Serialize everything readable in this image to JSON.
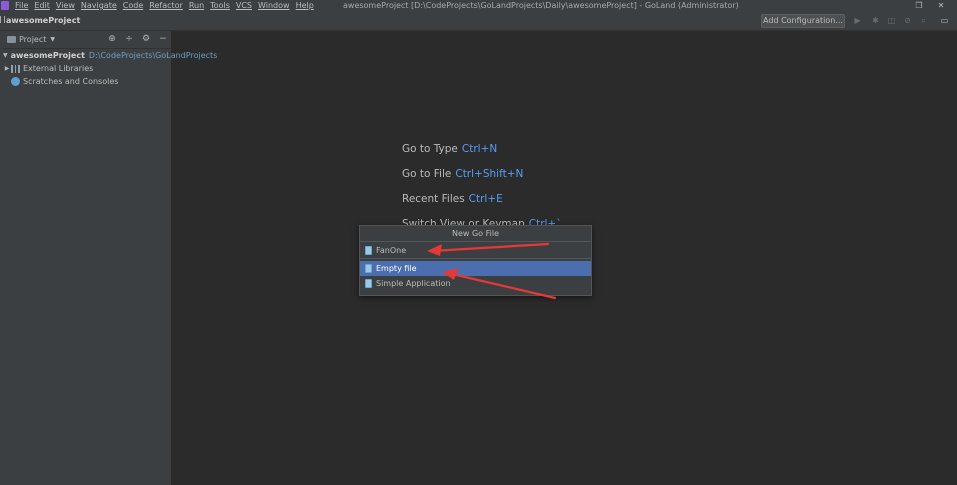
{
  "menubar": {
    "items": [
      "File",
      "Edit",
      "View",
      "Navigate",
      "Code",
      "Refactor",
      "Run",
      "Tools",
      "VCS",
      "Window",
      "Help"
    ],
    "window_title": "awesomeProject [D:\\CodeProjects\\GoLandProjects\\Daily\\awesomeProject] - GoLand (Administrator)"
  },
  "navbar": {
    "project_name": "awesomeProject",
    "add_configuration": "Add Configuration..."
  },
  "project_panel": {
    "title": "Project",
    "tree": {
      "root_name": "awesomeProject",
      "root_path": "D:\\CodeProjects\\GoLandProjects",
      "external_libraries": "External Libraries",
      "scratches": "Scratches and Consoles"
    }
  },
  "welcome": {
    "go_to_type": "Go to Type",
    "go_to_type_shortcut": "Ctrl+N",
    "go_to_file": "Go to File",
    "go_to_file_shortcut": "Ctrl+Shift+N",
    "recent_files": "Recent Files",
    "recent_files_shortcut": "Ctrl+E",
    "switch_view": "Switch View or Keymap",
    "switch_view_shortcut": "Ctrl+`"
  },
  "popup": {
    "title": "New Go File",
    "items": [
      "FanOne",
      "Empty file",
      "Simple Application"
    ],
    "selected": "Empty file"
  },
  "colors": {
    "selection": "#4b6eaf",
    "shortcut": "#589df6",
    "annotation_arrow": "#e53935"
  }
}
